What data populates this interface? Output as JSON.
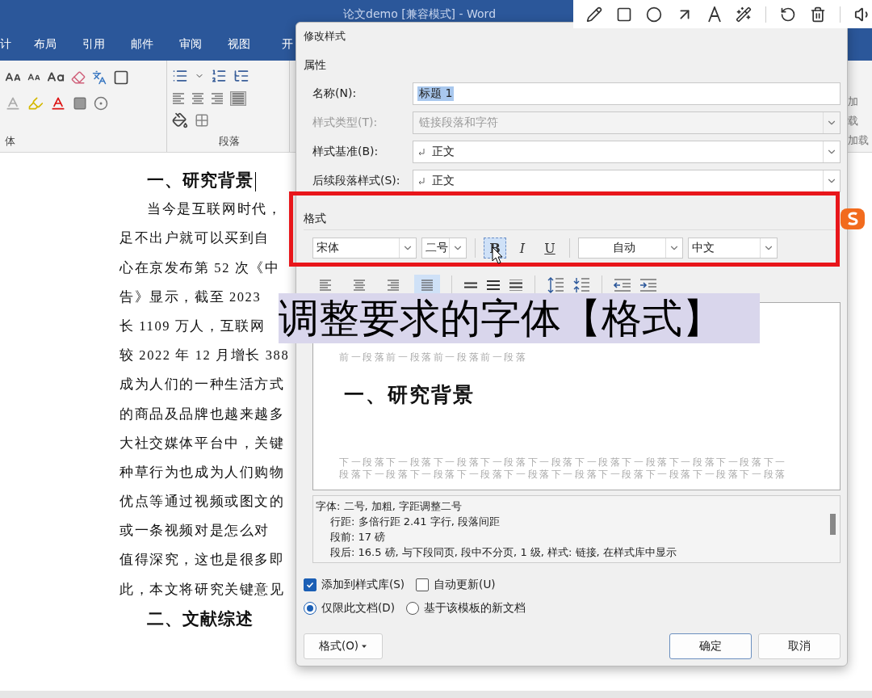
{
  "window": {
    "title": "论文demo [兼容模式] - Word"
  },
  "ribbon": {
    "tabs": [
      "计",
      "布局",
      "引用",
      "邮件",
      "审阅",
      "视图",
      "开"
    ],
    "groups": [
      "体",
      "段落"
    ],
    "addins": [
      "加",
      "载",
      "加载"
    ]
  },
  "document": {
    "lines": [
      {
        "kind": "heading",
        "text": "一、研究背景"
      },
      {
        "kind": "first",
        "text": "当今是互联网时代，"
      },
      {
        "kind": "body",
        "text": "足不出户就可以买到自"
      },
      {
        "kind": "body",
        "text": "心在京发布第 52 次《中"
      },
      {
        "kind": "body",
        "text": "告》显示，截至 2023"
      },
      {
        "kind": "body",
        "text": "长 1109 万人，互联网"
      },
      {
        "kind": "body",
        "text": "较 2022 年 12 月增长 388"
      },
      {
        "kind": "body",
        "text": "成为人们的一种生活方式"
      },
      {
        "kind": "body",
        "text": "的商品及品牌也越来越多"
      },
      {
        "kind": "body",
        "text": "大社交媒体平台中，关键"
      },
      {
        "kind": "body",
        "text": "种草行为也成为人们购物"
      },
      {
        "kind": "body",
        "text": "优点等通过视频或图文的"
      },
      {
        "kind": "body",
        "text": "或一条视频对是怎么对"
      },
      {
        "kind": "body",
        "text": "值得深究，这也是很多即"
      },
      {
        "kind": "body",
        "text": "此，本文将研究关键意见"
      },
      {
        "kind": "heading",
        "text": "二、文献综述"
      }
    ]
  },
  "dialog": {
    "title": "修改样式",
    "properties_label": "属性",
    "fields": [
      {
        "label": "名称(N):",
        "value": "标题 1",
        "kind": "text",
        "highlighted": true,
        "disabled": false,
        "paragraph_mark": false
      },
      {
        "label": "样式类型(T):",
        "value": "链接段落和字符",
        "kind": "select",
        "highlighted": false,
        "disabled": true,
        "paragraph_mark": false
      },
      {
        "label": "样式基准(B):",
        "value": "正文",
        "kind": "select",
        "highlighted": false,
        "disabled": false,
        "paragraph_mark": true
      },
      {
        "label": "后续段落样式(S):",
        "value": "正文",
        "kind": "select",
        "highlighted": false,
        "disabled": false,
        "paragraph_mark": true
      }
    ],
    "format": {
      "label": "格式",
      "font": "宋体",
      "size": "二号",
      "styles": [
        {
          "kind": "bold",
          "label": "B",
          "selected": true
        },
        {
          "kind": "italic",
          "label": "I",
          "selected": false
        },
        {
          "kind": "underline",
          "label": "U",
          "selected": false
        }
      ],
      "color_choice": "自动",
      "script": "中文"
    },
    "alignment": [
      {
        "kind": "left",
        "selected": false
      },
      {
        "kind": "center",
        "selected": false
      },
      {
        "kind": "right",
        "selected": false
      },
      {
        "kind": "justify",
        "selected": true
      }
    ],
    "preview": {
      "before_text": "前一段落前一段落前一段落前一段落",
      "heading": "一、研究背景",
      "after_lines": [
        "下一段落下一段落下一段落下一段落下一段落下一段落下一段落下一段落下一段落下一",
        "段落下一段落下一段落下一段落下一段落下一段落下一段落下一段落下一段落下一段落"
      ]
    },
    "description": [
      "字体: 二号, 加粗, 字距调整二号",
      "行距: 多倍行距 2.41 字行, 段落间距",
      "段前: 17 磅",
      "段后: 16.5 磅, 与下段同页, 段中不分页, 1 级, 样式: 链接, 在样式库中显示"
    ],
    "checkboxes": [
      {
        "label": "添加到样式库(S)",
        "checked": true
      },
      {
        "label": "自动更新(U)",
        "checked": false
      }
    ],
    "radios": [
      {
        "label": "仅限此文档(D)",
        "selected": true
      },
      {
        "label": "基于该模板的新文档",
        "selected": false
      }
    ],
    "buttons": [
      {
        "label": "格式(O)",
        "kind": "menu"
      },
      {
        "label": "确定",
        "kind": "default"
      },
      {
        "label": "取消",
        "kind": "normal"
      }
    ]
  },
  "caption": "调整要求的字体【格式】"
}
